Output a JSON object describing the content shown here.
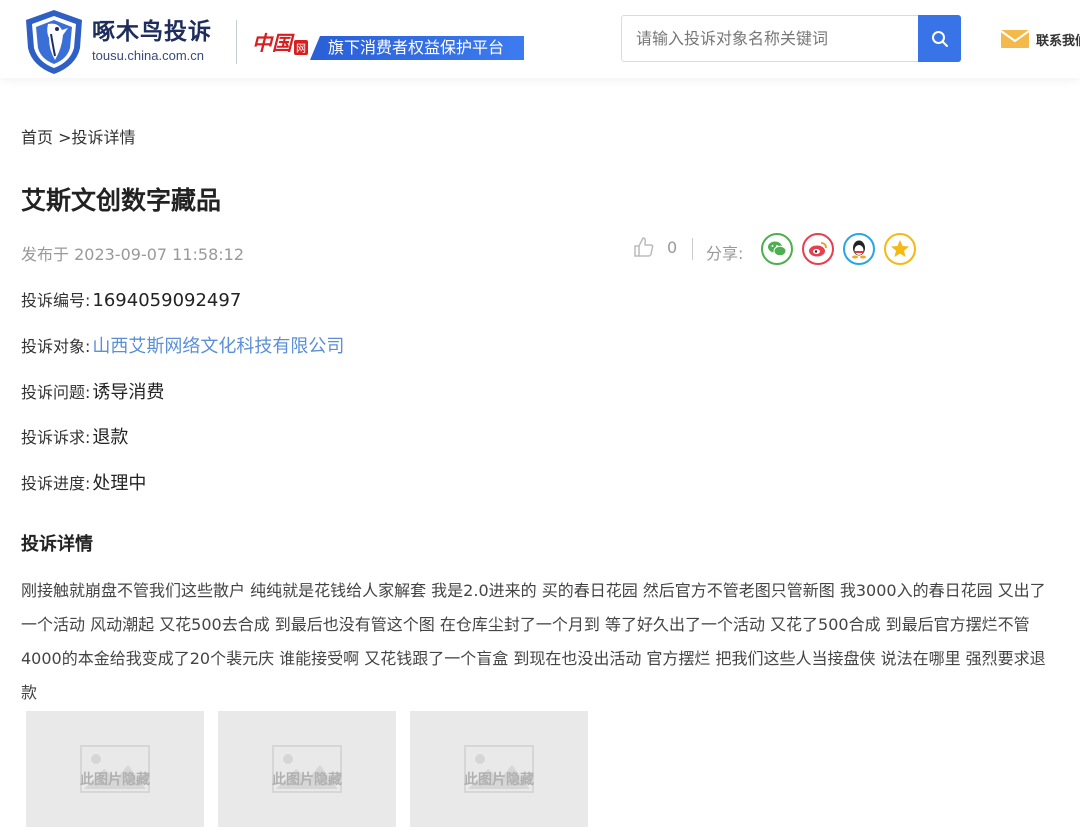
{
  "header": {
    "logo_title": "啄木鸟投诉",
    "logo_url": "tousu.china.com.cn",
    "china_logo_text": "中国",
    "china_logo_net": "网",
    "platform_slogan": "旗下消费者权益保护平台",
    "search_placeholder": "请输入投诉对象名称关键词",
    "contact_label": "联系我们",
    "colors": {
      "accent": "#3873e8",
      "brand_dark": "#1f2d5c",
      "red": "#d81e1e"
    }
  },
  "breadcrumb": {
    "home": "首页",
    "separator": " >",
    "current": "投诉详情"
  },
  "page": {
    "title": "艾斯文创数字藏品",
    "published": "发布于 2023-09-07 11:58:12",
    "like_count": "0",
    "share_label": "分享:",
    "share_icons": [
      "wechat-icon",
      "weibo-icon",
      "qq-icon",
      "qzone-icon"
    ]
  },
  "fields": [
    {
      "label": "投诉编号:",
      "value": "1694059092497"
    },
    {
      "label": "投诉对象:",
      "value": "山西艾斯网络文化科技有限公司"
    },
    {
      "label": "投诉问题:",
      "value": "诱导消费"
    },
    {
      "label": "投诉诉求:",
      "value": "退款"
    },
    {
      "label": "投诉进度:",
      "value": "处理中"
    }
  ],
  "detail": {
    "title": "投诉详情",
    "text": "刚接触就崩盘不管我们这些散户 纯纯就是花钱给人家解套 我是2.0进来的 买的春日花园 然后官方不管老图只管新图 我3000入的春日花园 又出了一个活动 风动潮起 又花500去合成 到最后也没有管这个图 在仓库尘封了一个月到 等了好久出了一个活动 又花了500合成 到最后官方摆烂不管 4000的本金给我变成了20个裴元庆 谁能接受啊 又花钱跟了一个盲盒 到现在也没出活动 官方摆烂 把我们这些人当接盘侠 说法在哪里 强烈要求退款",
    "images": [
      {
        "label": "此图片隐藏"
      },
      {
        "label": "此图片隐藏"
      },
      {
        "label": "此图片隐藏"
      }
    ]
  }
}
